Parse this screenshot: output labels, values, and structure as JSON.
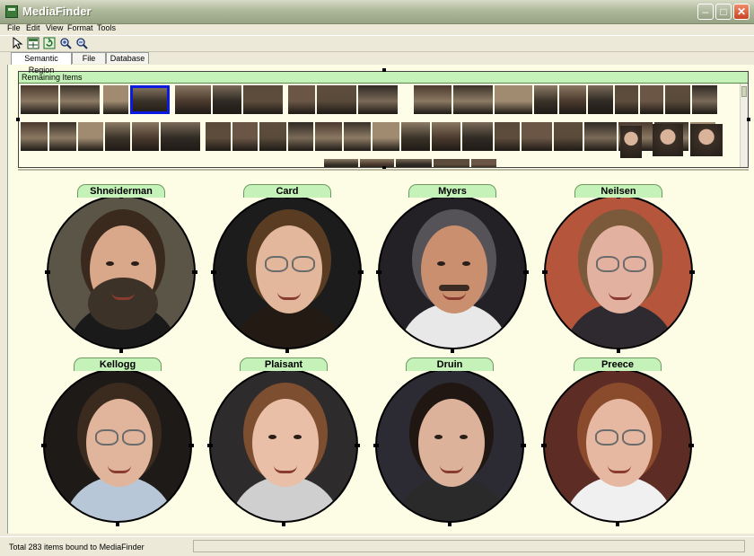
{
  "window": {
    "title": "MediaFinder"
  },
  "menu": [
    "File",
    "Edit",
    "View",
    "Format",
    "Tools"
  ],
  "toolbar": {
    "icons": [
      "pointer-icon",
      "grid-icon",
      "refresh-icon",
      "zoom-in-icon",
      "zoom-out-icon"
    ]
  },
  "tabs": [
    "Semantic Region",
    "File",
    "Database"
  ],
  "remaining": {
    "title": "Remaining Items"
  },
  "people": [
    "Shneiderman",
    "Card",
    "Myers",
    "Neilsen",
    "Kellogg",
    "Plaisant",
    "Druin",
    "Preece"
  ],
  "status": {
    "text": "Total 283 items bound to MediaFinder"
  }
}
